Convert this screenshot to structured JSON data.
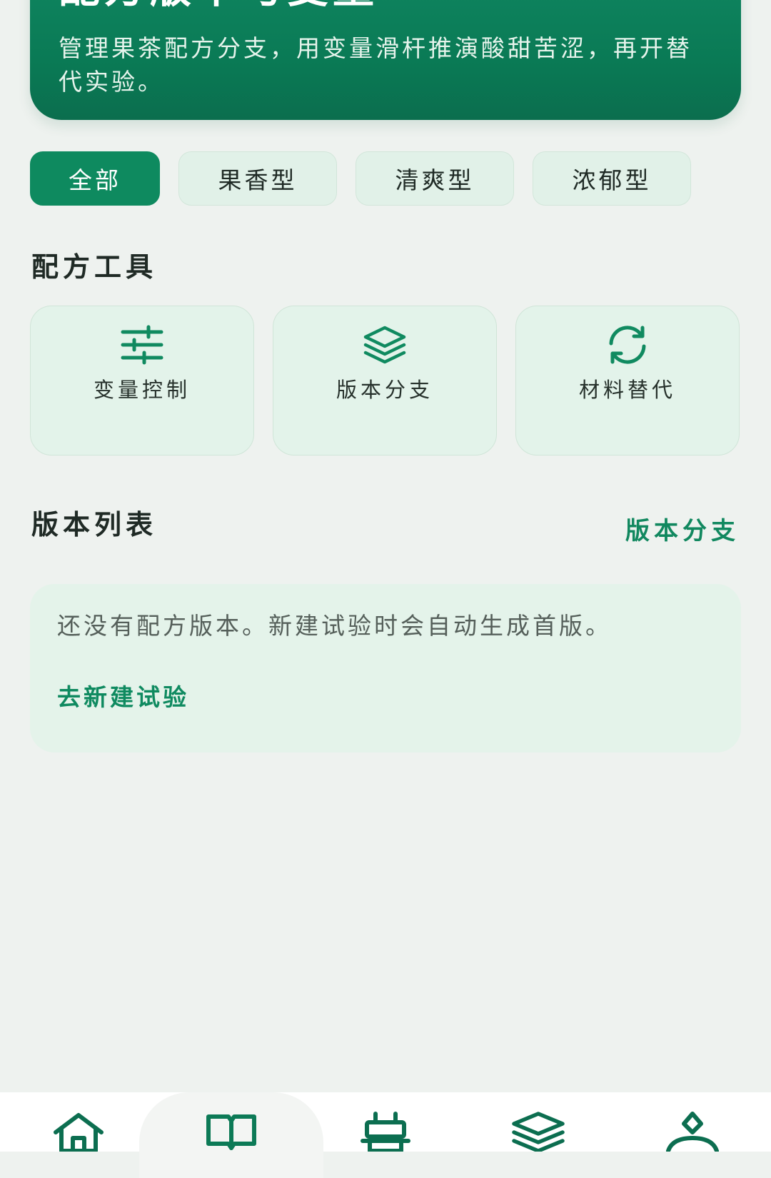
{
  "hero": {
    "title": "配方版本与变量",
    "description": "管理果茶配方分支，用变量滑杆推演酸甜苦涩，再开替代实验。"
  },
  "filters": [
    {
      "label": "全部",
      "active": true
    },
    {
      "label": "果香型",
      "active": false
    },
    {
      "label": "清爽型",
      "active": false
    },
    {
      "label": "浓郁型",
      "active": false
    }
  ],
  "tools_section": {
    "title": "配方工具",
    "items": [
      {
        "label": "变量控制",
        "icon": "sliders-icon"
      },
      {
        "label": "版本分支",
        "icon": "layers-icon"
      },
      {
        "label": "材料替代",
        "icon": "refresh-icon"
      }
    ]
  },
  "versions_section": {
    "title": "版本列表",
    "action_label": "版本分支",
    "empty_text": "还没有配方版本。新建试验时会自动生成首版。",
    "empty_action": "去新建试验"
  },
  "bottom_nav": {
    "items": [
      {
        "icon": "home-icon",
        "active": false
      },
      {
        "icon": "book-icon",
        "active": true
      },
      {
        "icon": "lab-icon",
        "active": false
      },
      {
        "icon": "layers-icon",
        "active": false
      },
      {
        "icon": "profile-icon",
        "active": false
      }
    ]
  },
  "colors": {
    "brand": "#0e8a5f",
    "background": "#eef2ef",
    "card": "#e3f3ea"
  }
}
